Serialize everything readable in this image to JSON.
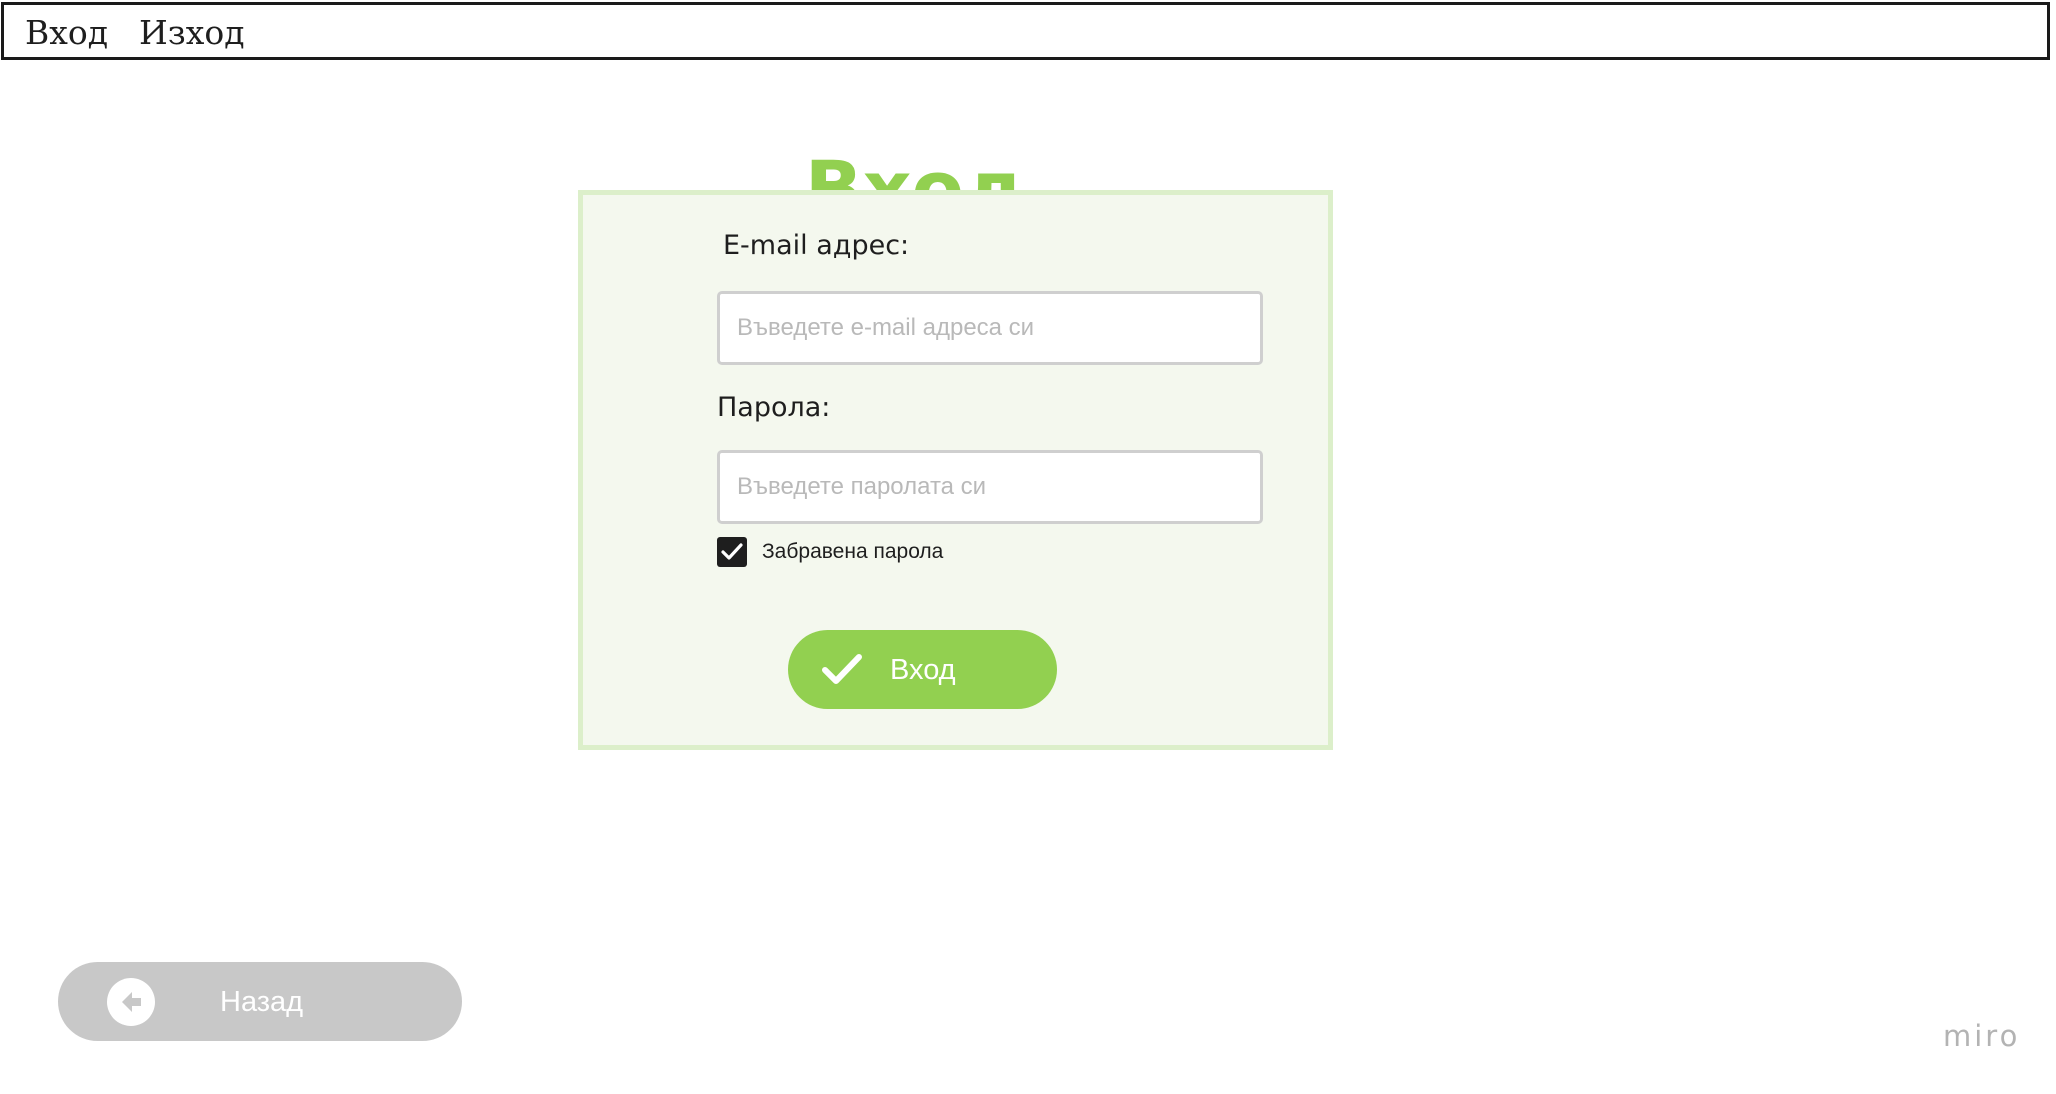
{
  "nav": {
    "items": [
      {
        "label": "Вход"
      },
      {
        "label": "Изход"
      }
    ]
  },
  "page": {
    "title": "Вход"
  },
  "form": {
    "email_label": "E-mail адрес:",
    "email_placeholder": "Въведете e-mail адреса си",
    "email_value": "",
    "password_label": "Парола:",
    "password_placeholder": "Въведете паролата си",
    "password_value": "",
    "checkbox_label": "Забравена парола",
    "checkbox_checked": true,
    "submit_label": "Вход",
    "submit_icon": "checkmark-icon"
  },
  "footer": {
    "back_label": "Назад",
    "back_icon": "arrow-left-icon",
    "watermark": "miro"
  },
  "colors": {
    "accent": "#92d050",
    "panel_bg": "#f4f8ee",
    "panel_border": "#dcefca",
    "back_button": "#c8c8c8",
    "text": "#1e1e1e"
  }
}
